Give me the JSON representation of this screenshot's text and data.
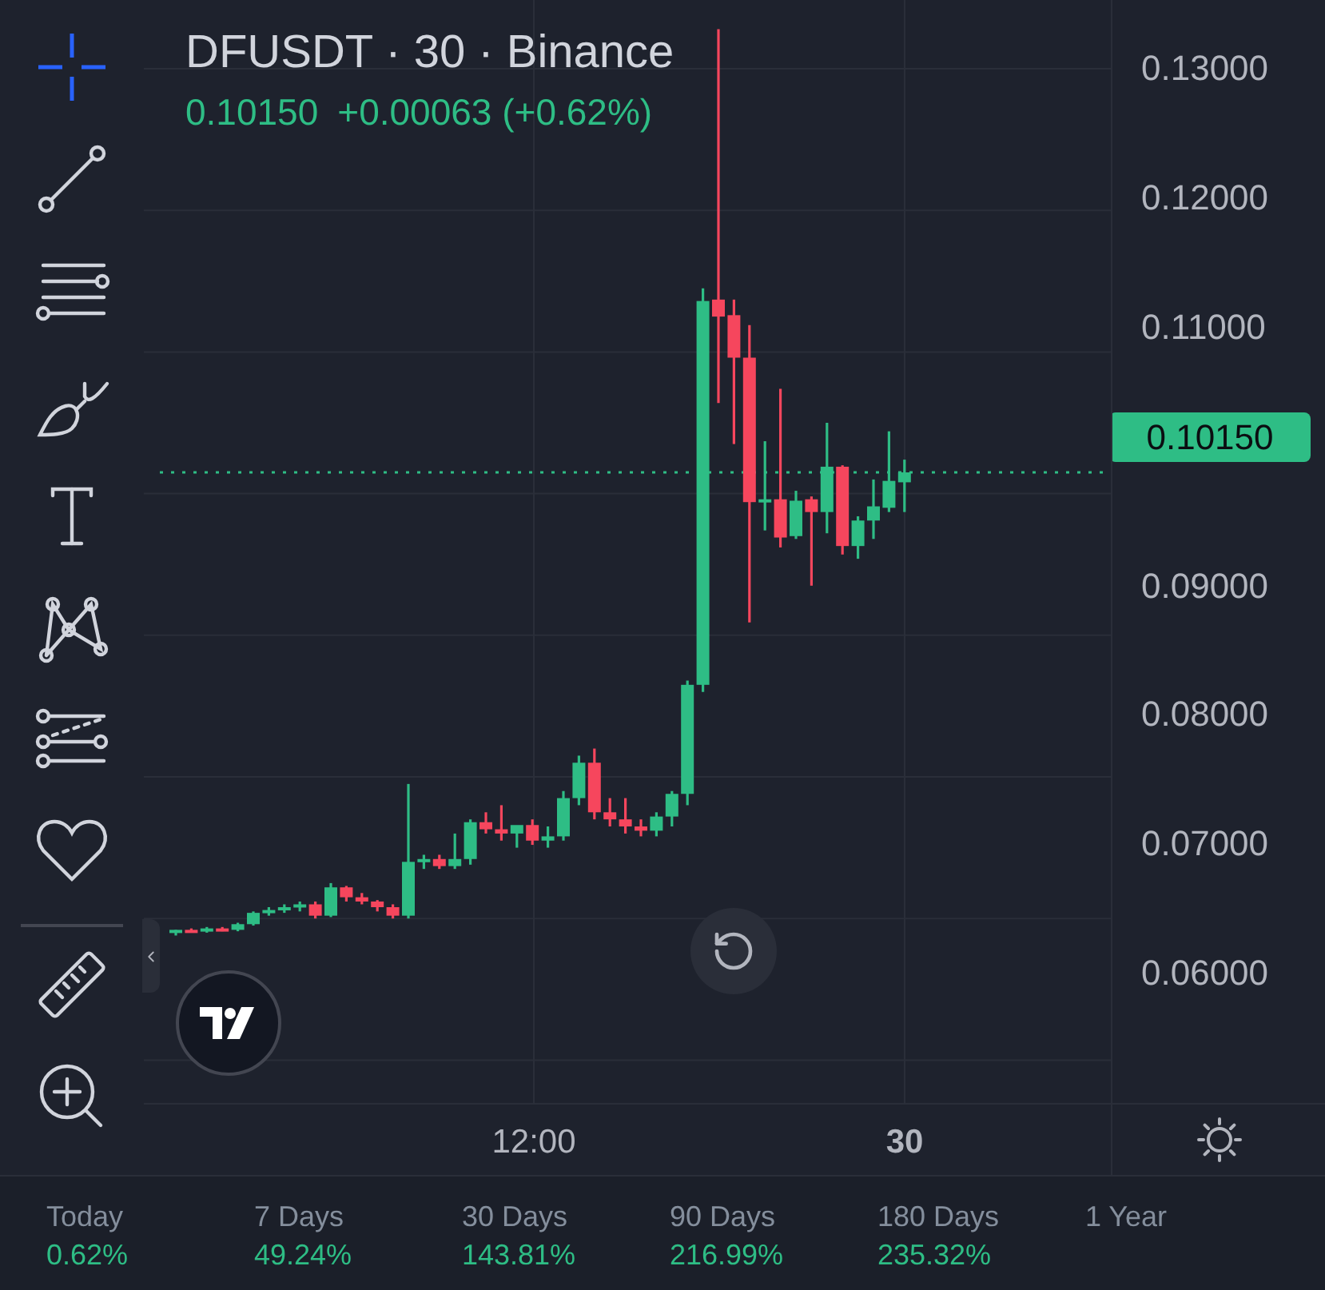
{
  "toolbar": [
    {
      "kind": "crosshair",
      "selected": true
    },
    {
      "kind": "trend-line",
      "selected": false
    },
    {
      "kind": "fib",
      "selected": false
    },
    {
      "kind": "brush",
      "selected": false
    },
    {
      "kind": "text",
      "selected": false
    },
    {
      "kind": "pattern",
      "selected": false
    },
    {
      "kind": "forecast",
      "selected": false
    },
    {
      "kind": "favorite",
      "selected": false
    },
    {
      "kind": "divider"
    },
    {
      "kind": "ruler",
      "selected": false
    },
    {
      "kind": "zoom",
      "selected": false
    }
  ],
  "header": {
    "title": "DFUSDT · 30 · Binance",
    "last_price": "0.10150",
    "change": "+0.00063 (+0.62%)"
  },
  "price_axis": [
    {
      "kind": "tick",
      "text": "0.13000"
    },
    {
      "kind": "tick",
      "text": "0.12000"
    },
    {
      "kind": "tick",
      "text": "0.11000"
    },
    {
      "kind": "current",
      "text": "0.10150"
    },
    {
      "kind": "tick",
      "text": "0.09000"
    },
    {
      "kind": "tick",
      "text": "0.08000"
    },
    {
      "kind": "tick",
      "text": "0.07000"
    },
    {
      "kind": "tick",
      "text": "0.06000"
    }
  ],
  "time_axis": [
    {
      "text": "12:00",
      "bold": false
    },
    {
      "text": "30",
      "bold": true
    }
  ],
  "stats": [
    {
      "label": "Today",
      "value": "0.62%"
    },
    {
      "label": "7 Days",
      "value": "49.24%"
    },
    {
      "label": "30 Days",
      "value": "143.81%"
    },
    {
      "label": "90 Days",
      "value": "216.99%"
    },
    {
      "label": "180 Days",
      "value": "235.32%"
    },
    {
      "label": "1 Year"
    }
  ]
}
